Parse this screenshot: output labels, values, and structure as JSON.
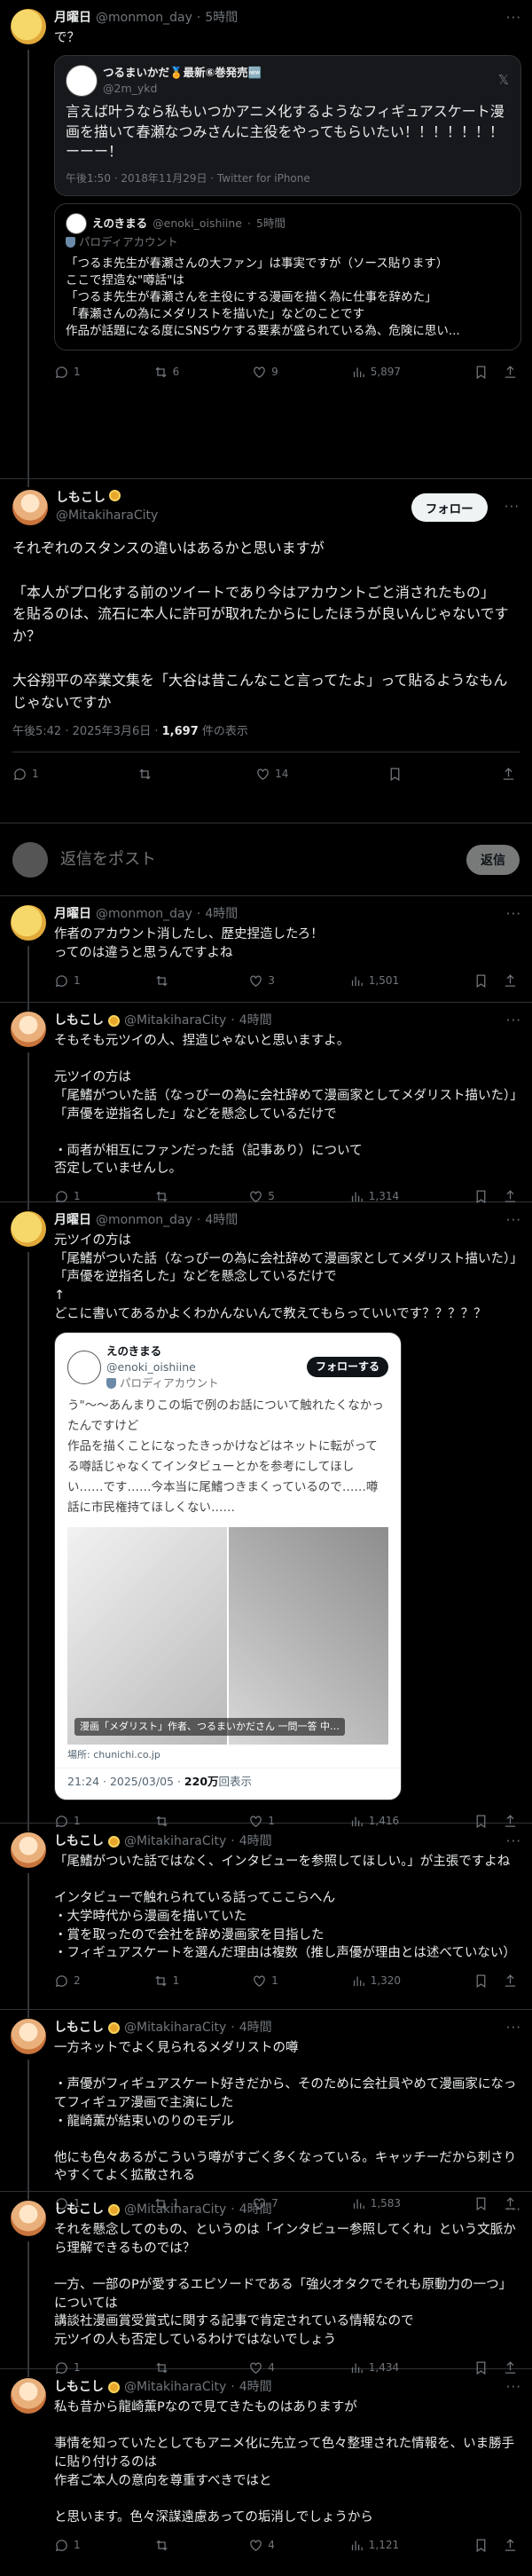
{
  "t1": {
    "name": "月曜日",
    "handle": "@monmon_day",
    "time": "5時間",
    "text": "で？",
    "quote": {
      "name": "つるまいかだ🏅最新⑥巻発売🆕",
      "handle": "@2m_ykd",
      "text": "言えば叶うなら私もいつかアニメ化するようなフィギュアスケート漫画を描いて春瀬なつみさんに主役をやってもらいたい！！！！！！！ーーー！",
      "time": "午後1:50 · 2018年11月29日 · Twitter for iPhone"
    },
    "quote2": {
      "name": "えのきまる",
      "handle": "@enoki_oishiine",
      "time": "5時間",
      "parody": "パロディアカウント",
      "text": "「つるま先生が春瀬さんの大ファン」は事実ですが（ソース貼ります）\nここで捏造な\"噂話\"は\n「つるま先生が春瀬さんを主役にする漫画を描く為に仕事を辞めた」\n「春瀬さんの為にメダリストを描いた」などのことです\n作品が話題になる度にSNSウケする要素が盛られている為、危険に思い..."
    },
    "stats": {
      "reply": "1",
      "rt": "6",
      "like": "9",
      "views": "5,897"
    }
  },
  "main": {
    "name": "しもこし",
    "handle": "@MitakiharaCity",
    "follow": "フォロー",
    "text": "それぞれのスタンスの違いはあるかと思いますが\n\n「本人がプロ化する前のツイートであり今はアカウントごと消されたもの」\nを貼るのは、流石に本人に許可が取れたからにしたほうが良いんじゃないですか？\n\n大谷翔平の卒業文集を「大谷は昔こんなこと言ってたよ」って貼るようなもんじゃないですか",
    "time": "午後5:42 · 2025年3月6日 · ",
    "views": "1,697",
    "views_label": " 件の表示",
    "stats": {
      "reply": "1",
      "rt": "",
      "like": "14"
    }
  },
  "reply_bar": {
    "placeholder": "返信をポスト",
    "button": "返信"
  },
  "replies": [
    {
      "name": "月曜日",
      "handle": "@monmon_day",
      "time": "4時間",
      "av": "moon",
      "badge": false,
      "text": "作者のアカウント消したし、歴史捏造したろ！\nってのは違うと思うんですよね",
      "stats": {
        "reply": "1",
        "rt": "",
        "like": "3",
        "views": "1,501"
      }
    },
    {
      "name": "しもこし",
      "handle": "@MitakiharaCity",
      "time": "4時間",
      "av": "girl",
      "badge": true,
      "text": "そもそも元ツイの人、捏造じゃないと思いますよ。\n\n元ツイの方は\n「尾鰭がついた話（なっぴーの為に会社辞めて漫画家としてメダリスト描いた）」「声優を逆指名した」などを懸念しているだけで\n\n・両者が相互にファンだった話（記事あり）について\n否定していませんし。",
      "stats": {
        "reply": "1",
        "rt": "",
        "like": "5",
        "views": "1,314"
      }
    },
    {
      "name": "月曜日",
      "handle": "@monmon_day",
      "time": "4時間",
      "av": "moon",
      "badge": false,
      "text": "元ツイの方は\n「尾鰭がついた話（なっぴーの為に会社辞めて漫画家としてメダリスト描いた）」「声優を逆指名した」などを懸念しているだけで\n↑\nどこに書いてあるかよくわかんないんで教えてもらっていいです？？？？？",
      "embed": {
        "name": "えのきまる",
        "handle": "@enoki_oishiine",
        "parody": "パロディアカウント",
        "follow": "フォローする",
        "text": "う\"〜〜あんまりこの垢で例のお話について触れたくなかったんですけど\n作品を描くことになったきっかけなどはネットに転がってる噂話じゃなくてインタビューとかを参考にしてほしい……です……今本当に尾鰭つきまくっているので……噂話に市民権持てほしくない……",
        "caption": "漫画「メダリスト」作者、つるまいかださん 一問一答 中…",
        "domain": "場所: chunichi.co.jp",
        "time": "21:24 · 2025/03/05 · ",
        "views": "220万",
        "views_label": "回表示"
      },
      "stats": {
        "reply": "1",
        "rt": "",
        "like": "1",
        "views": "1,416"
      }
    },
    {
      "name": "しもこし",
      "handle": "@MitakiharaCity",
      "time": "4時間",
      "av": "girl",
      "badge": true,
      "text": "「尾鰭がついた話ではなく、インタビューを参照してほしい。」が主張ですよね\n\nインタビューで触れられている話ってここらへん\n・大学時代から漫画を描いていた\n・賞を取ったので会社を辞め漫画家を目指した\n・フィギュアスケートを選んだ理由は複数（推し声優が理由とは述べていない）",
      "stats": {
        "reply": "2",
        "rt": "1",
        "like": "1",
        "views": "1,320"
      }
    },
    {
      "name": "しもこし",
      "handle": "@MitakiharaCity",
      "time": "4時間",
      "av": "girl",
      "badge": true,
      "text": "一方ネットでよく見られるメダリストの噂\n\n・声優がフィギュアスケート好きだから、そのために会社員やめて漫画家になってフィギュア漫画で主演にした\n・龍崎薫が結束いのりのモデル\n\n他にも色々あるがこういう噂がすごく多くなっている。キャッチーだから刺さりやすくてよく拡散される",
      "stats": {
        "reply": "1",
        "rt": "1",
        "like": "7",
        "views": "1,583"
      }
    },
    {
      "name": "しもこし",
      "handle": "@MitakiharaCity",
      "time": "4時間",
      "av": "girl",
      "badge": true,
      "text": "それを懸念してのもの、というのは「インタビュー参照してくれ」という文脈から理解できるものでは？\n\n一方、一部のPが愛するエピソードである「強火オタクでそれも原動力の一つ」については\n講談社漫画賞受賞式に関する記事で肯定されている情報なので\n元ツイの人も否定しているわけではないでしょう",
      "stats": {
        "reply": "1",
        "rt": "",
        "like": "4",
        "views": "1,434"
      }
    },
    {
      "name": "しもこし",
      "handle": "@MitakiharaCity",
      "time": "4時間",
      "av": "girl",
      "badge": true,
      "text": "私も昔から龍崎薫Pなので見てきたものはありますが\n\n事情を知っていたとしてもアニメ化に先立って色々整理された情報を、いま勝手に貼り付けるのは\n作者ご本人の意向を尊重すべきではと\n\nと思います。色々深謀遠慮あっての垢消しでしょうから",
      "stats": {
        "reply": "1",
        "rt": "",
        "like": "4",
        "views": "1,121"
      }
    }
  ]
}
